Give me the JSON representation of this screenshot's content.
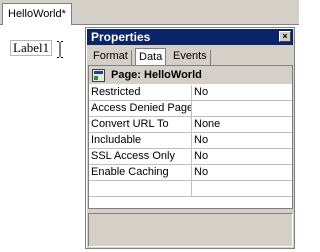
{
  "document_tab": {
    "title": "HelloWorld*"
  },
  "canvas": {
    "label_control_text": "Label1"
  },
  "properties_window": {
    "title": "Properties",
    "close_glyph": "×",
    "tabs": [
      {
        "label": "Format"
      },
      {
        "label": "Data",
        "active": true
      },
      {
        "label": "Events"
      }
    ],
    "object_header": "Page: HelloWorld",
    "rows": [
      {
        "name": "Restricted",
        "value": "No"
      },
      {
        "name": "Access Denied Page",
        "value": ""
      },
      {
        "name": "Convert URL To",
        "value": "None"
      },
      {
        "name": "Includable",
        "value": "No"
      },
      {
        "name": "SSL Access Only",
        "value": "No"
      },
      {
        "name": "Enable Caching",
        "value": "No"
      }
    ]
  }
}
